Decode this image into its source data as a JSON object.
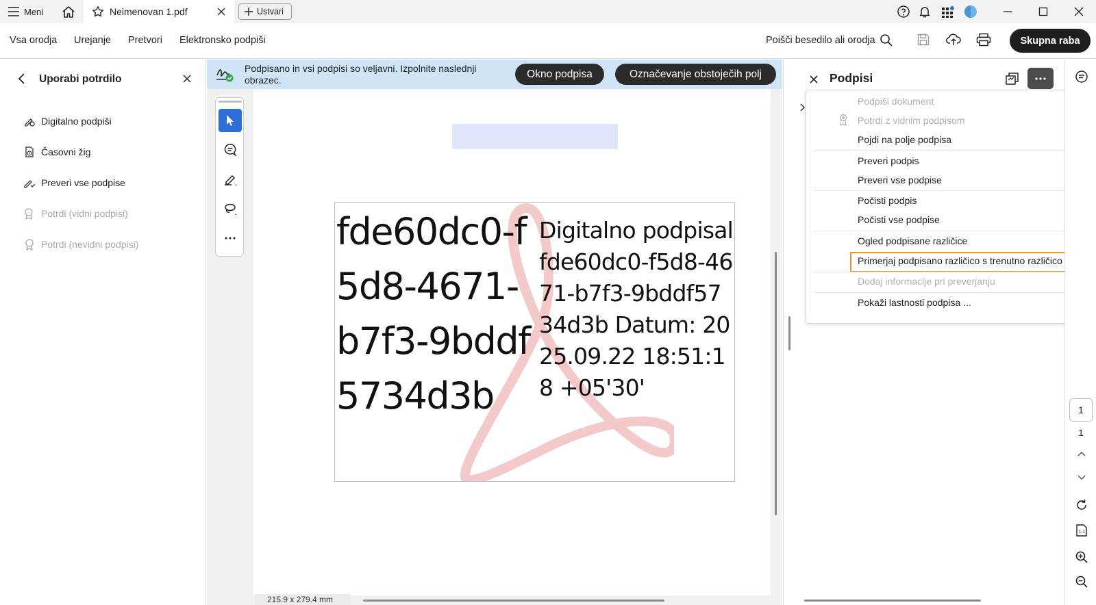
{
  "titlebar": {
    "menu_label": "Meni",
    "tab_title": "Neimenovan 1.pdf",
    "create_label": "Ustvari"
  },
  "toolbar": {
    "all_tools": "Vsa orodja",
    "edit": "Urejanje",
    "convert": "Pretvori",
    "esign": "Elektronsko podpiši",
    "search_label": "Poišči besedilo ali orodja",
    "share_label": "Skupna raba"
  },
  "left_panel": {
    "title": "Uporabi potrdilo",
    "items": [
      {
        "label": "Digitalno podpiši",
        "enabled": true
      },
      {
        "label": "Časovni žig",
        "enabled": true
      },
      {
        "label": "Preveri vse podpise",
        "enabled": true
      },
      {
        "label": "Potrdi (vidni podpisi)",
        "enabled": false
      },
      {
        "label": "Potrdi (nevidni podpisi)",
        "enabled": false
      }
    ]
  },
  "notice": {
    "text": "Podpisano in vsi podpisi so veljavni.  Izpolnite naslednji obrazec.",
    "sig_pane_button": "Okno podpisa",
    "highlight_fields_button": "Označevanje obstoječih polj"
  },
  "document": {
    "signature_name": "fde60dc0-f5d8-4671-b7f3-9bddf5734d3b",
    "signature_details": "Digitalno podpisal fde60dc0-f5d8-4671-b7f3-9bddf5734d3b Datum: 2025.09.22 18:51:18 +05'30'",
    "page_size": "215.9 x 279.4 mm"
  },
  "right_panel": {
    "title": "Podpisi"
  },
  "context_menu": {
    "items": [
      {
        "label": "Podpiši dokument",
        "enabled": false
      },
      {
        "label": "Potrdi z vidnim podpisom",
        "enabled": false
      },
      {
        "label": "Pojdi na polje podpisa",
        "enabled": true
      },
      {
        "label": "Preveri podpis",
        "enabled": true
      },
      {
        "label": "Preveri vse podpise",
        "enabled": true
      },
      {
        "label": "Počisti podpis",
        "enabled": true
      },
      {
        "label": "Počisti vse podpise",
        "enabled": true
      },
      {
        "label": "Ogled podpisane različice",
        "enabled": true
      },
      {
        "label": "Primerjaj podpisano različico s trenutno različico",
        "enabled": true,
        "highlighted": true
      },
      {
        "label": "Dodaj informacije pri preverjanju",
        "enabled": false
      },
      {
        "label": "Pokaži lastnosti podpisa ...",
        "enabled": true
      }
    ]
  },
  "page_nav": {
    "current_page": "1",
    "total_pages": "1"
  },
  "colors": {
    "accent_blue": "#2d6ed6",
    "notice_bg": "#cfe5f7",
    "highlight_orange": "#e8932e",
    "dark_button": "#1f1f1f"
  }
}
